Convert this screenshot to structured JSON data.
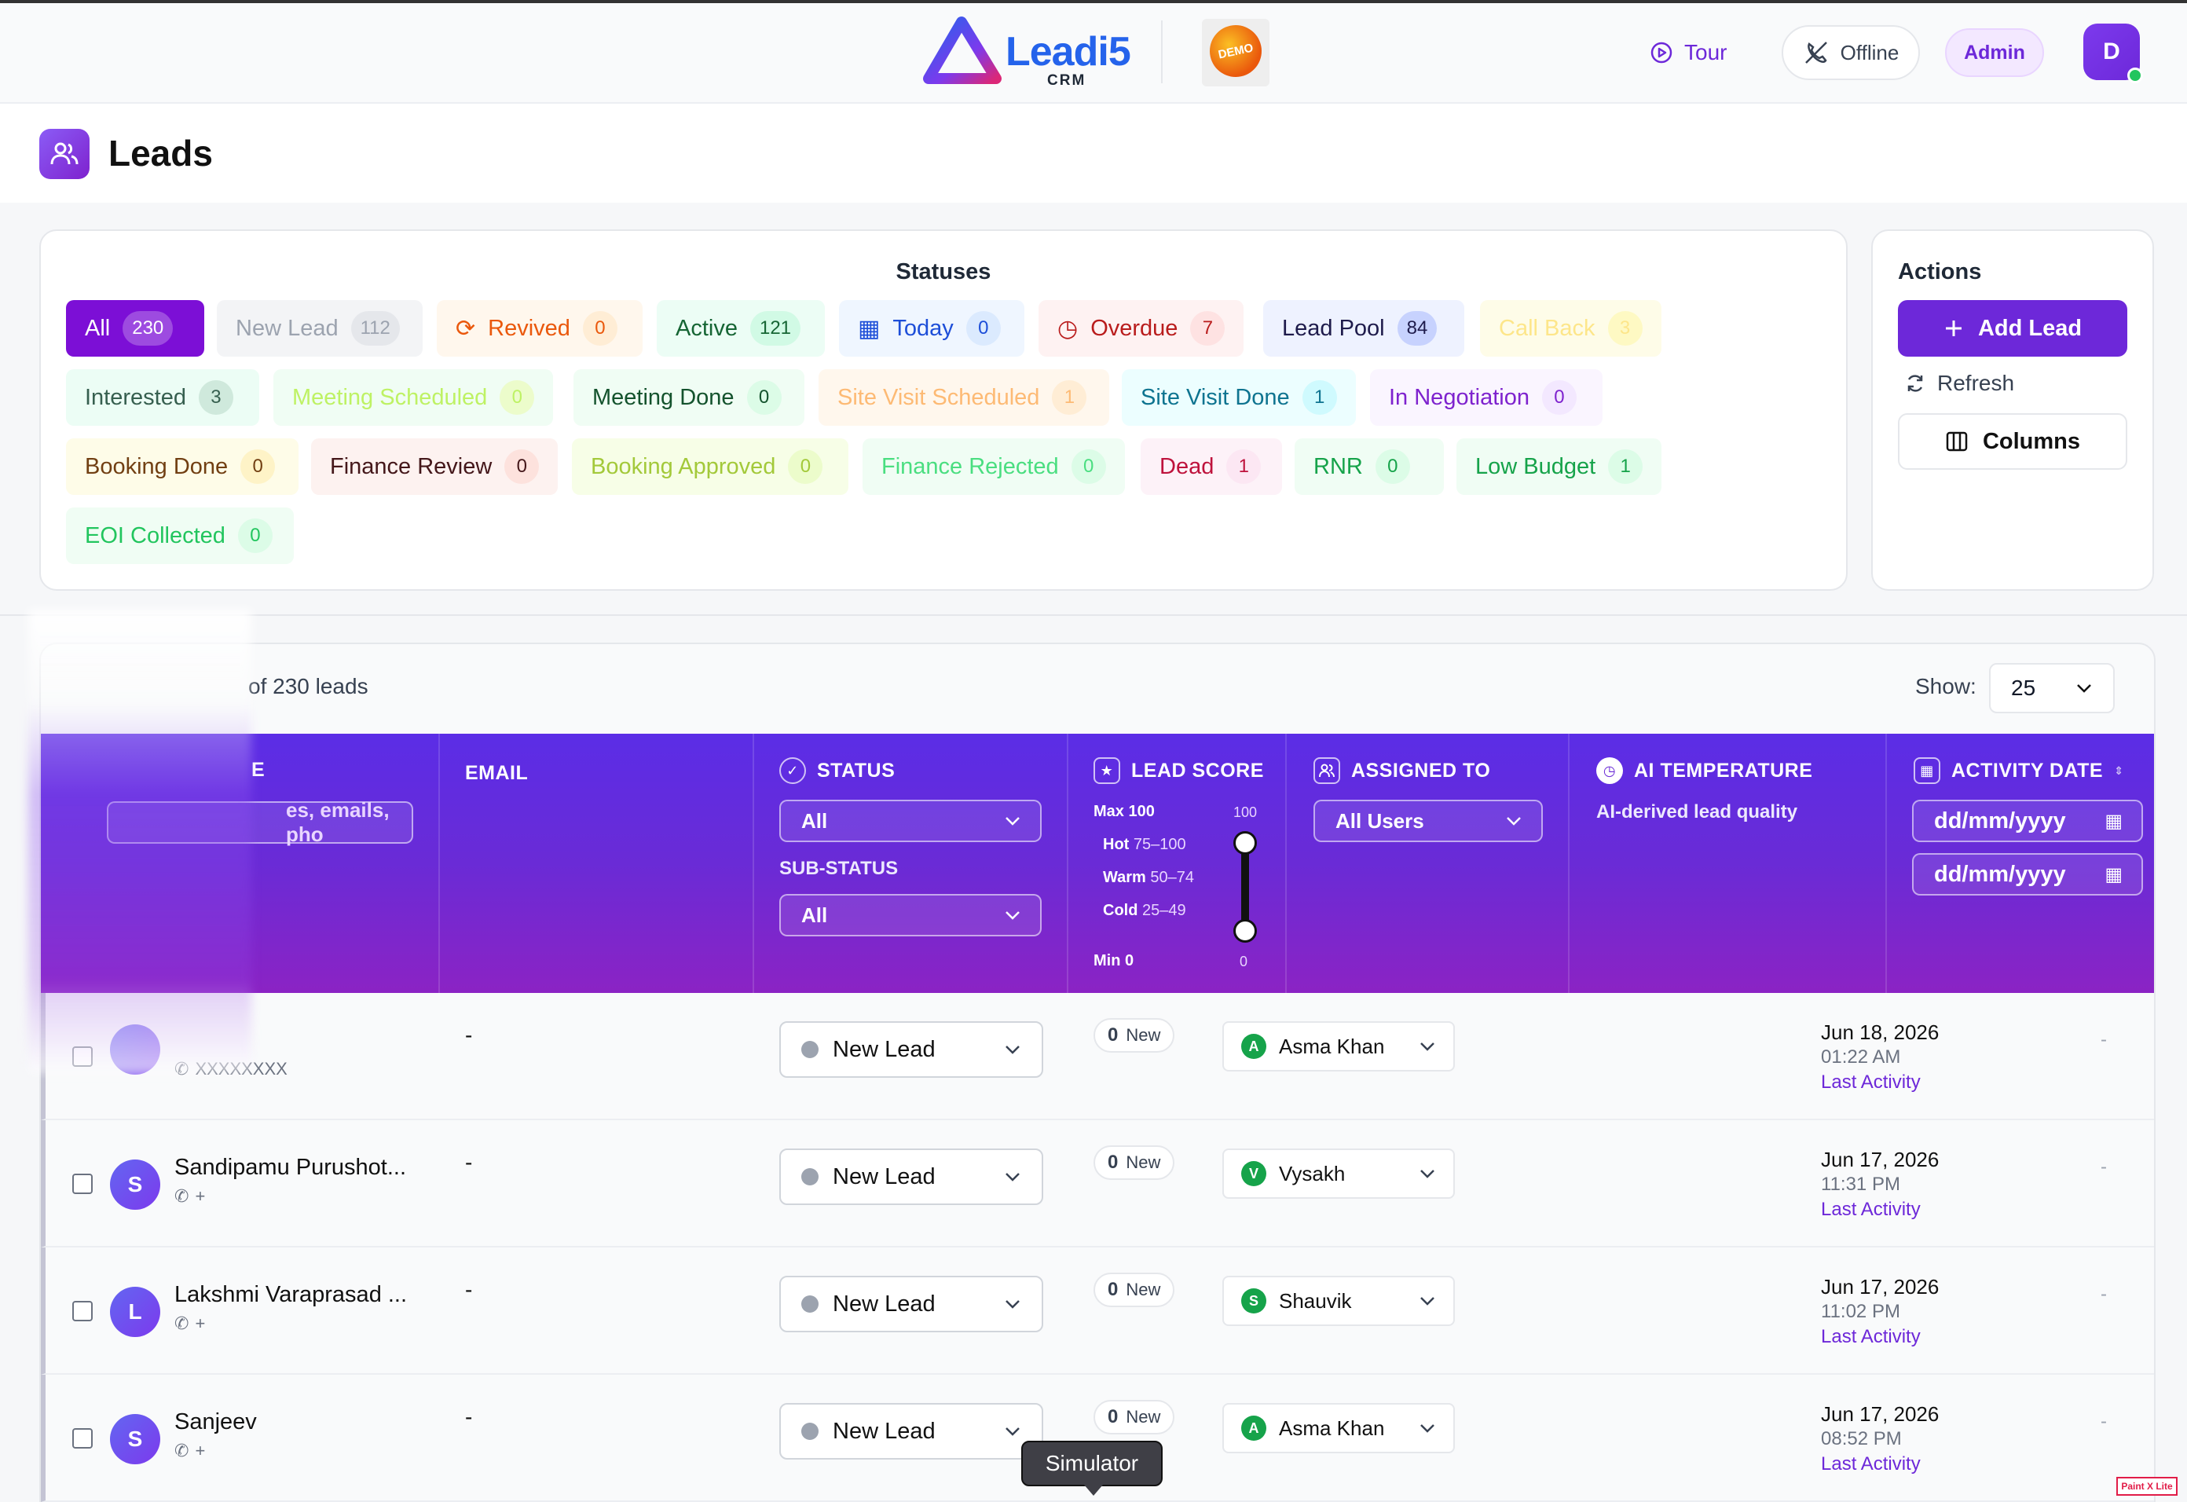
{
  "app": {
    "logo_text": "Leadi5",
    "logo_sub": "CRM",
    "demo_badge": "DEMO",
    "tour_label": "Tour",
    "offline_label": "Offline",
    "role_label": "Admin",
    "avatar_initial": "D"
  },
  "page": {
    "title": "Leads"
  },
  "statuses": {
    "heading": "Statuses",
    "items": [
      {
        "label": "All",
        "count": "230"
      },
      {
        "label": "New Lead",
        "count": "112"
      },
      {
        "label": "Revived",
        "count": "0"
      },
      {
        "label": "Active",
        "count": "121"
      },
      {
        "label": "Today",
        "count": "0"
      },
      {
        "label": "Overdue",
        "count": "7"
      },
      {
        "label": "Lead Pool",
        "count": "84"
      },
      {
        "label": "Call Back",
        "count": "3"
      },
      {
        "label": "Interested",
        "count": "3"
      },
      {
        "label": "Meeting Scheduled",
        "count": "0"
      },
      {
        "label": "Meeting Done",
        "count": "0"
      },
      {
        "label": "Site Visit Scheduled",
        "count": "1"
      },
      {
        "label": "Site Visit Done",
        "count": "1"
      },
      {
        "label": "In Negotiation",
        "count": "0"
      },
      {
        "label": "Booking Done",
        "count": "0"
      },
      {
        "label": "Finance Review",
        "count": "0"
      },
      {
        "label": "Booking Approved",
        "count": "0"
      },
      {
        "label": "Finance Rejected",
        "count": "0"
      },
      {
        "label": "Dead",
        "count": "1"
      },
      {
        "label": "RNR",
        "count": "0"
      },
      {
        "label": "Low Budget",
        "count": "1"
      },
      {
        "label": "EOI Collected",
        "count": "0"
      }
    ]
  },
  "actions": {
    "heading": "Actions",
    "add_lead": "Add Lead",
    "refresh": "Refresh",
    "columns": "Columns"
  },
  "table": {
    "count_text": "of 230 leads",
    "show_label": "Show:",
    "show_value": "25",
    "columns": {
      "name_partial": "E",
      "search_placeholder": "es, emails, pho",
      "email": "EMAIL",
      "status": "STATUS",
      "status_filter": "All",
      "sub_status": "SUB-STATUS",
      "sub_status_filter": "All",
      "lead_score": "LEAD SCORE",
      "score_max": "Max 100",
      "score_min": "Min 0",
      "score_top": "100",
      "score_bottom": "0",
      "score_hot": "Hot",
      "score_hot_range": "75–100",
      "score_warm": "Warm",
      "score_warm_range": "50–74",
      "score_cold": "Cold",
      "score_cold_range": "25–49",
      "assigned_to": "ASSIGNED TO",
      "assigned_filter": "All Users",
      "ai_temp": "AI TEMPERATURE",
      "ai_temp_sub": "AI-derived lead quality",
      "activity_date": "ACTIVITY DATE",
      "date_from": "dd/mm/yyyy",
      "date_to": "dd/mm/yyyy"
    },
    "rows": [
      {
        "initial": "",
        "name": "",
        "phone": "XXXXXXXX",
        "email": "-",
        "status": "New Lead",
        "score": "0",
        "score_label": "New",
        "assignee_initial": "A",
        "assignee": "Asma Khan",
        "date": "Jun 18, 2026",
        "time": "01:22 AM",
        "activity": "Last Activity",
        "ai": "-"
      },
      {
        "initial": "S",
        "name": "Sandipamu Purushot...",
        "phone": "+",
        "email": "-",
        "status": "New Lead",
        "score": "0",
        "score_label": "New",
        "assignee_initial": "V",
        "assignee": "Vysakh",
        "date": "Jun 17, 2026",
        "time": "11:31 PM",
        "activity": "Last Activity",
        "ai": "-"
      },
      {
        "initial": "L",
        "name": "Lakshmi Varaprasad ...",
        "phone": "+",
        "email": "-",
        "status": "New Lead",
        "score": "0",
        "score_label": "New",
        "assignee_initial": "S",
        "assignee": "Shauvik",
        "date": "Jun 17, 2026",
        "time": "11:02 PM",
        "activity": "Last Activity",
        "ai": "-"
      },
      {
        "initial": "S",
        "name": "Sanjeev",
        "phone": "+",
        "email": "-",
        "status": "New Lead",
        "score": "0",
        "score_label": "New",
        "assignee_initial": "A",
        "assignee": "Asma Khan",
        "date": "Jun 17, 2026",
        "time": "08:52 PM",
        "activity": "Last Activity",
        "ai": "-"
      }
    ]
  },
  "tooltip": "Simulator",
  "extension_badge": "Paint X Lite"
}
